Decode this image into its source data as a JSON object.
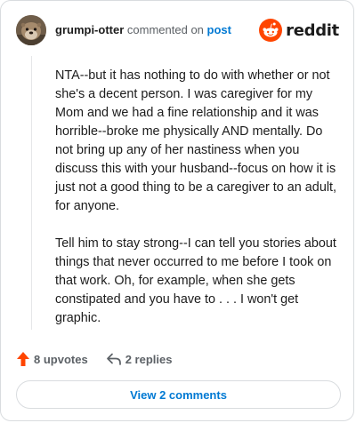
{
  "header": {
    "username": "grumpi-otter",
    "action_text": "commented on",
    "target_text": "post",
    "logo_text": "reddit"
  },
  "comment": {
    "paragraphs": [
      "NTA--but it has nothing to do with whether or not she's a decent person. I was caregiver for my Mom and we had a fine relationship and it was horrible--broke me physically AND mentally. Do not bring up any of her nastiness when you discuss this with your husband--focus on how it is just not a good thing to be a caregiver to an adult, for anyone.",
      "Tell him to stay strong--I can tell you stories about things that never occurred to me before I took on that work. Oh, for example, when she gets constipated and you have to . . . I won't get graphic."
    ]
  },
  "actions": {
    "upvotes_label": "8 upvotes",
    "replies_label": "2 replies"
  },
  "footer": {
    "view_comments_label": "View 2 comments"
  },
  "colors": {
    "accent": "#0079d3",
    "upvote": "#ff4500",
    "reddit_orange": "#ff4500"
  },
  "icons": {
    "avatar": "otter-avatar",
    "logo": "reddit-snoo-icon",
    "upvote": "upvote-arrow-icon",
    "reply": "reply-arrow-icon"
  }
}
